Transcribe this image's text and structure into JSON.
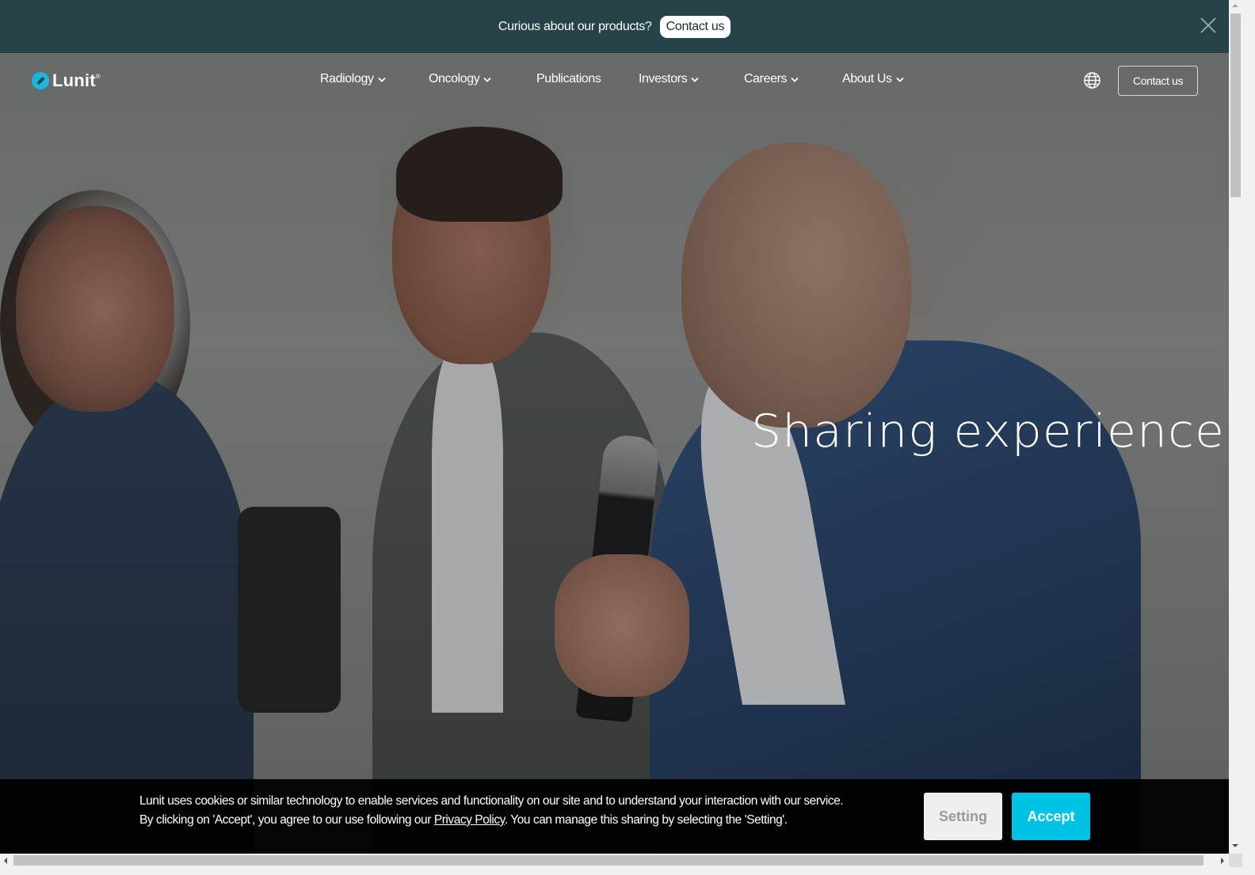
{
  "announcement": {
    "text": "Curious about our products?",
    "button_label": "Contact us",
    "close_icon": "close-icon"
  },
  "brand": {
    "name": "Lunit",
    "registered_mark": "®",
    "accent_color": "#1ab6dd"
  },
  "nav": {
    "items": [
      {
        "label": "Radiology",
        "has_dropdown": true
      },
      {
        "label": "Oncology",
        "has_dropdown": true
      },
      {
        "label": "Publications",
        "has_dropdown": false
      },
      {
        "label": "Investors",
        "has_dropdown": true
      },
      {
        "label": "Careers",
        "has_dropdown": true
      },
      {
        "label": "About Us",
        "has_dropdown": true
      }
    ],
    "language_icon": "globe-icon",
    "contact_label": "Contact us"
  },
  "hero": {
    "title": "Sharing experience"
  },
  "cookie_banner": {
    "line1": "Lunit uses cookies or similar technology to enable services and functionality on our site and to understand your interaction with our service.",
    "line2_before": "By clicking on 'Accept', you agree to our use following our ",
    "privacy_link": "Privacy Policy",
    "line2_after": ". You can manage this sharing by selecting the 'Setting'.",
    "setting_label": "Setting",
    "accept_label": "Accept",
    "accept_color": "#00c3e6"
  },
  "colors": {
    "announcement_bg": "#26434a",
    "cookie_bg": "#000000"
  }
}
